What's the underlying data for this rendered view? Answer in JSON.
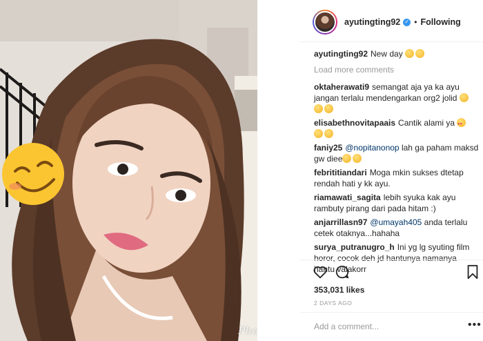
{
  "post": {
    "username": "ayutingting92",
    "verified_mark": "✓",
    "separator": "•",
    "follow_status": "Following",
    "caption": {
      "user": "ayutingting92",
      "text": "New day"
    }
  },
  "load_more": "Load more comments",
  "comments": [
    {
      "user": "oktaherawati9",
      "text": "semangat aja ya ka ayu jangan terlalu mendengarkan org2 jolid"
    },
    {
      "user": "elisabethnovitapaais",
      "text": "Cantik alami ya"
    },
    {
      "user": "faniy25",
      "mention": "@nopitanonop",
      "text": "lah ga paham maksd gw diee"
    },
    {
      "user": "febrititiandari",
      "text": "Moga mkin sukses dtetap rendah hati y kk ayu."
    },
    {
      "user": "riamawati_sagita",
      "text": "lebih syuka kak ayu rambuty pirang dari pada hitam :)"
    },
    {
      "user": "anjarrillasn97",
      "mention": "@umayah405",
      "text": "anda terlalu cetek otaknya...hahaha"
    },
    {
      "user": "surya_putranugro_h",
      "text": "Ini yg lg syuting film horor, cocok deh jd hantunya namanya hantu valakorr"
    }
  ],
  "likes": "353,031 likes",
  "date": "2 DAYS AGO",
  "add_comment_placeholder": "Add a comment...",
  "more_dots": "•••",
  "watermark": "PhotoGrid",
  "icons": [
    "heart-icon",
    "comment-icon",
    "bookmark-icon"
  ]
}
